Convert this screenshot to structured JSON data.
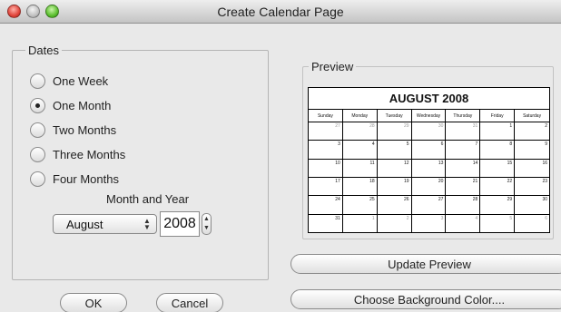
{
  "window": {
    "title": "Create Calendar Page"
  },
  "dates": {
    "legend": "Dates",
    "options": [
      {
        "label": "One Week",
        "selected": false
      },
      {
        "label": "One Month",
        "selected": true
      },
      {
        "label": "Two Months",
        "selected": false
      },
      {
        "label": "Three Months",
        "selected": false
      },
      {
        "label": "Four Months",
        "selected": false
      }
    ],
    "month_year_label": "Month and Year",
    "month": "August",
    "year": "2008"
  },
  "buttons": {
    "ok": "OK",
    "cancel": "Cancel",
    "update_preview": "Update Preview",
    "choose_background": "Choose Background Color...."
  },
  "preview": {
    "legend": "Preview",
    "calendar_title": "AUGUST 2008",
    "weekdays": [
      "Sunday",
      "Monday",
      "Tuesday",
      "Wednesday",
      "Thursday",
      "Friday",
      "Saturday"
    ],
    "weeks": [
      [
        "27",
        "28",
        "29",
        "30",
        "31",
        "1",
        "2"
      ],
      [
        "3",
        "4",
        "5",
        "6",
        "7",
        "8",
        "9"
      ],
      [
        "10",
        "11",
        "12",
        "13",
        "14",
        "15",
        "16"
      ],
      [
        "17",
        "18",
        "19",
        "20",
        "21",
        "22",
        "23"
      ],
      [
        "24",
        "25",
        "26",
        "27",
        "28",
        "29",
        "30"
      ],
      [
        "31",
        "1",
        "2",
        "3",
        "4",
        "5",
        "6"
      ]
    ],
    "dim_cells": [
      [
        0,
        0
      ],
      [
        0,
        1
      ],
      [
        0,
        2
      ],
      [
        0,
        3
      ],
      [
        0,
        4
      ],
      [
        5,
        1
      ],
      [
        5,
        2
      ],
      [
        5,
        3
      ],
      [
        5,
        4
      ],
      [
        5,
        5
      ],
      [
        5,
        6
      ]
    ]
  }
}
